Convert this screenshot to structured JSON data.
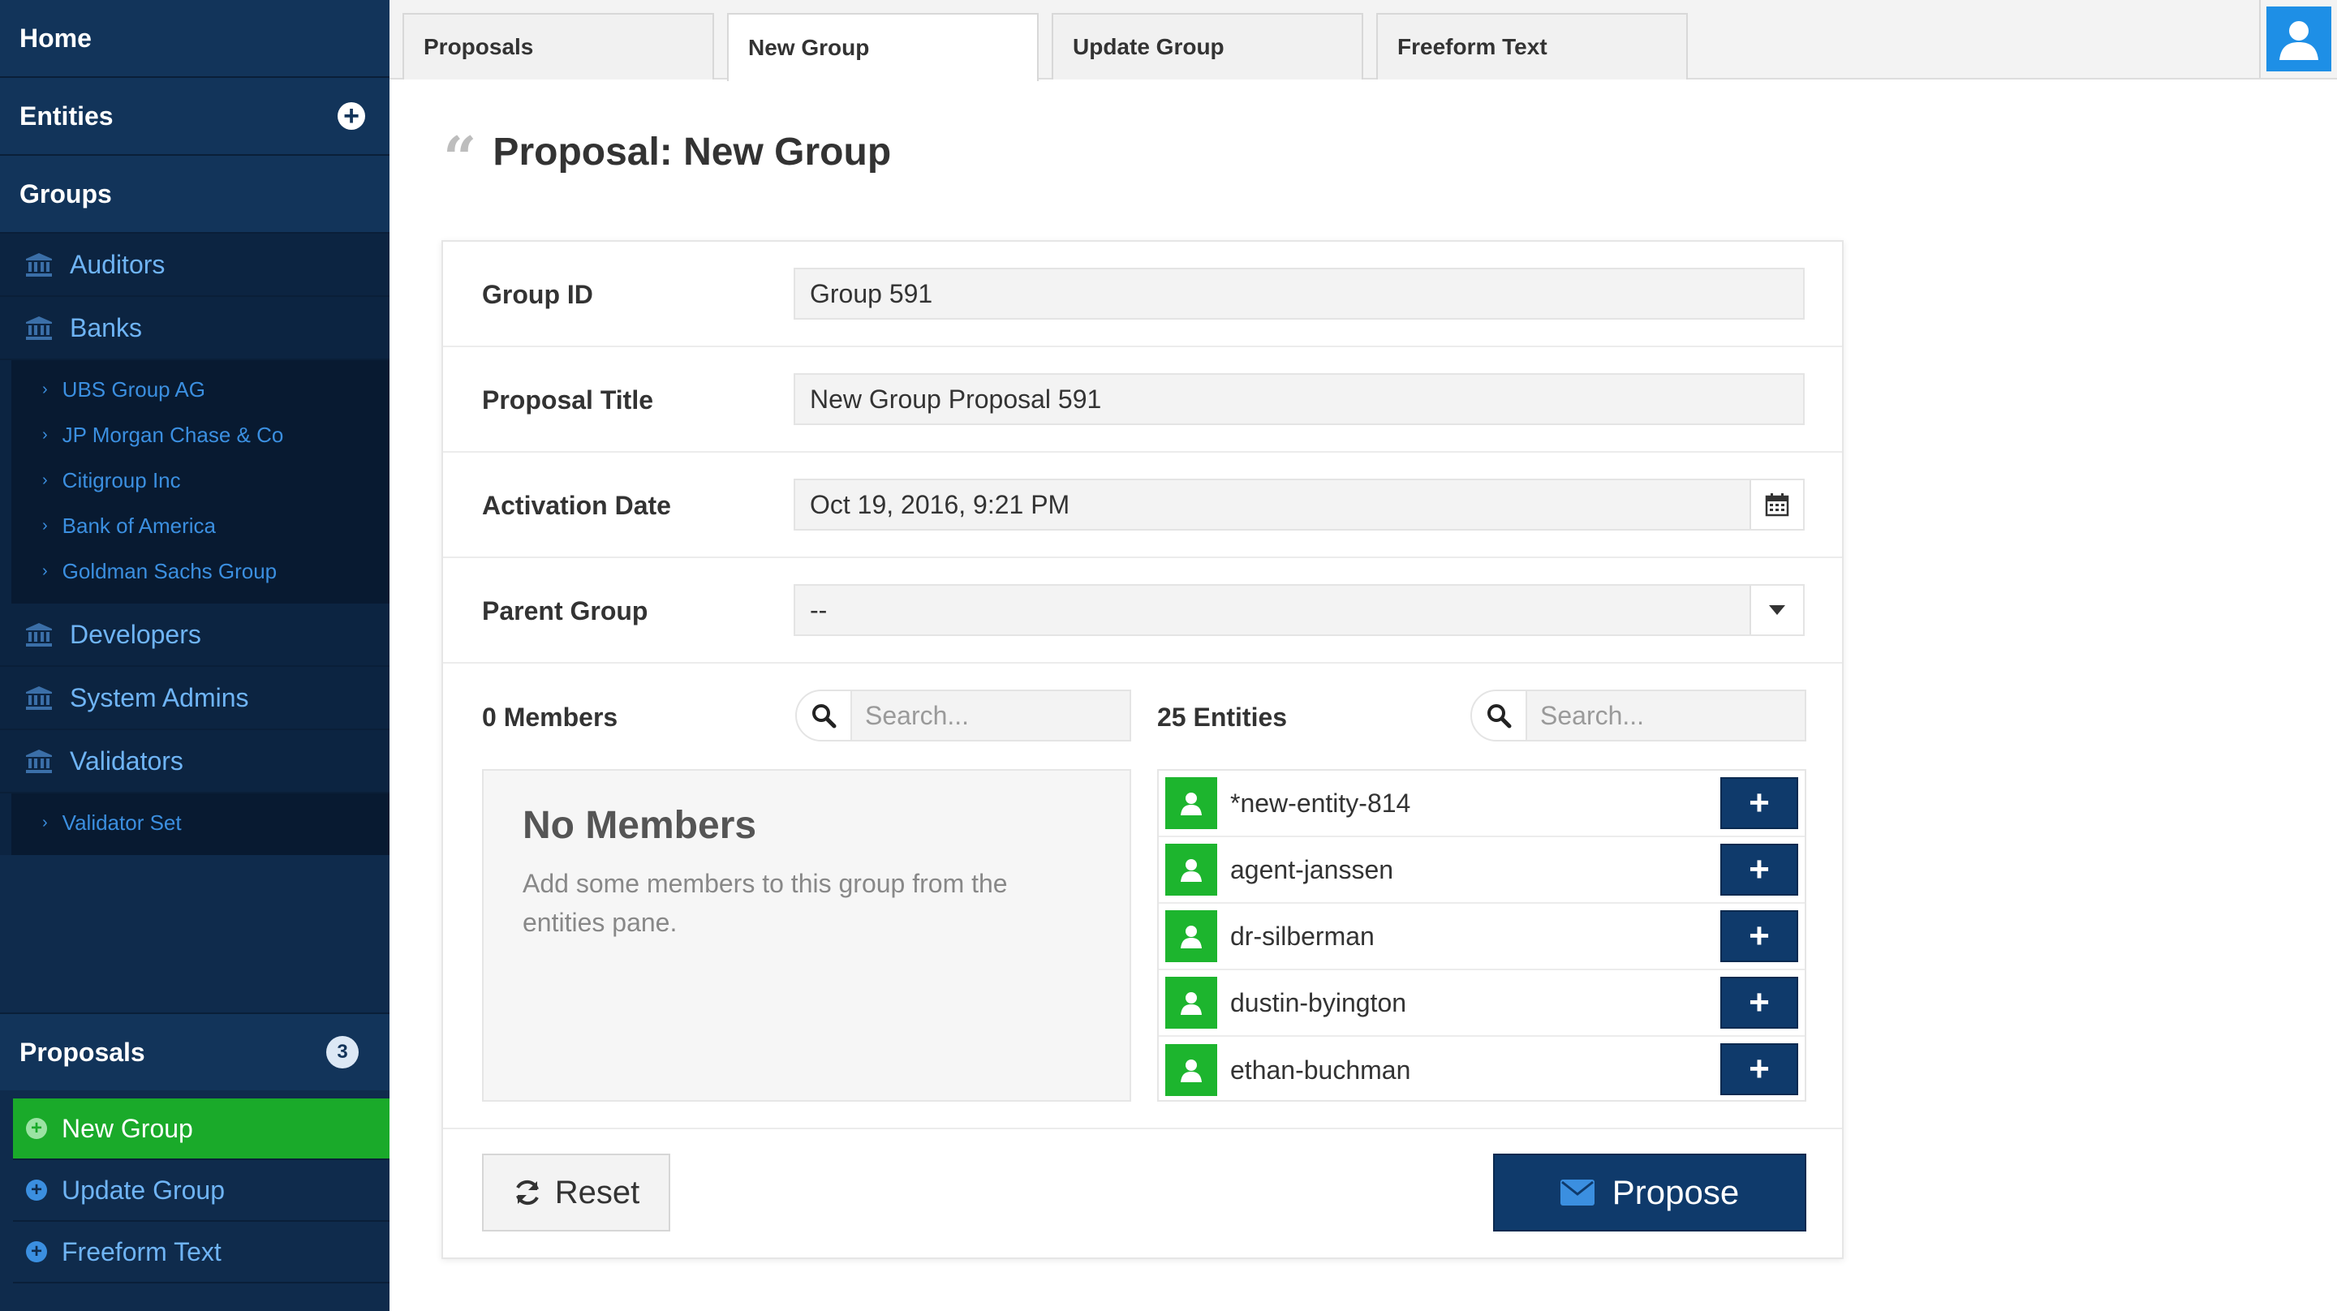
{
  "sidebar": {
    "home_label": "Home",
    "entities_label": "Entities",
    "groups_label": "Groups",
    "groups": [
      {
        "label": "Auditors"
      },
      {
        "label": "Banks"
      }
    ],
    "banks_sub": [
      {
        "label": "UBS Group AG"
      },
      {
        "label": "JP Morgan Chase & Co"
      },
      {
        "label": "Citigroup Inc"
      },
      {
        "label": "Bank of America"
      },
      {
        "label": "Goldman Sachs Group"
      }
    ],
    "groups_more": [
      {
        "label": "Developers"
      },
      {
        "label": "System Admins"
      },
      {
        "label": "Validators"
      }
    ],
    "validators_sub": [
      {
        "label": "Validator Set"
      }
    ],
    "proposals_label": "Proposals",
    "proposals_count": "3",
    "proposal_items": [
      {
        "label": "New Group",
        "active": true
      },
      {
        "label": "Update Group",
        "active": false
      },
      {
        "label": "Freeform Text",
        "active": false
      }
    ]
  },
  "tabs": [
    {
      "label": "Proposals",
      "active": false
    },
    {
      "label": "New Group",
      "active": true
    },
    {
      "label": "Update Group",
      "active": false
    },
    {
      "label": "Freeform Text",
      "active": false
    }
  ],
  "page": {
    "title": "Proposal: New Group"
  },
  "form": {
    "group_id_label": "Group ID",
    "group_id_value": "Group 591",
    "proposal_title_label": "Proposal Title",
    "proposal_title_value": "New Group Proposal 591",
    "activation_date_label": "Activation Date",
    "activation_date_value": "Oct 19, 2016, 9:21 PM",
    "parent_group_label": "Parent Group",
    "parent_group_value": "--"
  },
  "members": {
    "label": "0 Members",
    "search_placeholder": "Search...",
    "empty_title": "No Members",
    "empty_text": "Add some members to this group from the entities pane."
  },
  "entities": {
    "label": "25 Entities",
    "search_placeholder": "Search...",
    "items": [
      {
        "name": "*new-entity-814"
      },
      {
        "name": "agent-janssen"
      },
      {
        "name": "dr-silberman"
      },
      {
        "name": "dustin-byington"
      },
      {
        "name": "ethan-buchman"
      }
    ]
  },
  "actions": {
    "reset_label": "Reset",
    "propose_label": "Propose"
  },
  "colors": {
    "sidebar_bg": "#0f2b4c",
    "active_green": "#1aaa2a",
    "primary_button": "#0f3a6b",
    "link_blue": "#3b8fe0"
  }
}
